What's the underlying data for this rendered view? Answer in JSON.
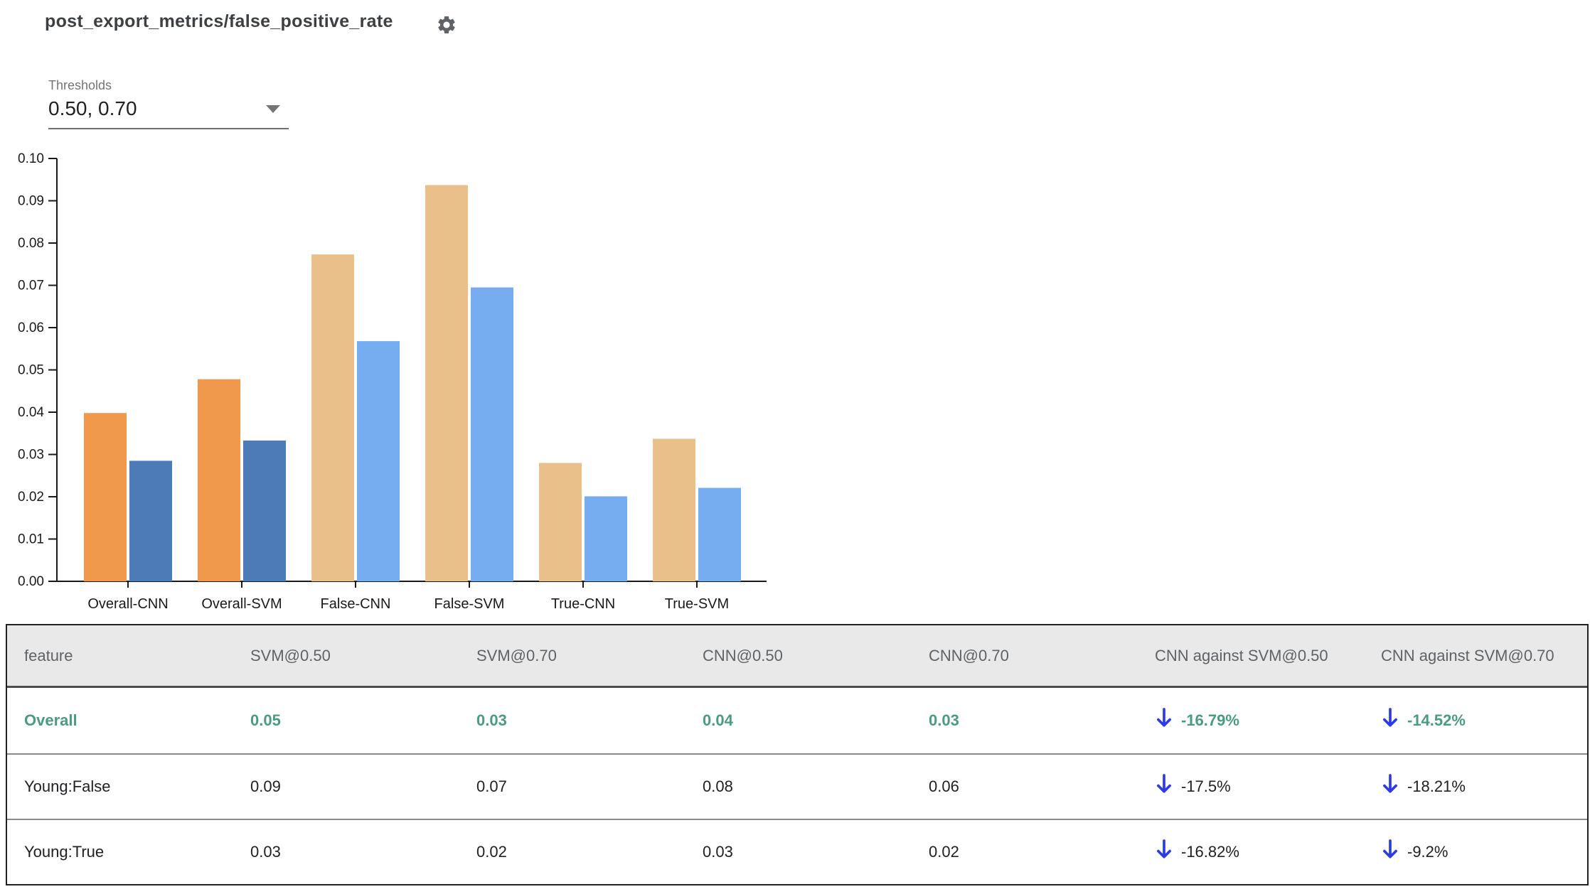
{
  "header": {
    "title": "post_export_metrics/false_positive_rate",
    "settings_icon": "gear"
  },
  "controls": {
    "thresholds_label": "Thresholds",
    "thresholds_value": "0.50, 0.70",
    "dropdown_icon": "caret-down"
  },
  "chart_data": {
    "type": "bar",
    "title": "post_export_metrics/false_positive_rate",
    "categories": [
      "Overall-CNN",
      "Overall-SVM",
      "False-CNN",
      "False-SVM",
      "True-CNN",
      "True-SVM"
    ],
    "series": [
      {
        "name": "threshold 0.50",
        "values": [
          0.0398,
          0.0478,
          0.0773,
          0.0937,
          0.028,
          0.0337
        ],
        "colors": [
          "#F0994D",
          "#F0994D",
          "#E9C089",
          "#E9C089",
          "#E9C089",
          "#E9C089"
        ]
      },
      {
        "name": "threshold 0.70",
        "values": [
          0.0285,
          0.0333,
          0.0568,
          0.0695,
          0.0201,
          0.0221
        ],
        "colors": [
          "#4C7BB8",
          "#4C7BB8",
          "#75ADF0",
          "#75ADF0",
          "#75ADF0",
          "#75ADF0"
        ]
      }
    ],
    "xlabel": "",
    "ylabel": "",
    "ylim": [
      0,
      0.1
    ],
    "yticks": [
      "0.00",
      "0.01",
      "0.02",
      "0.03",
      "0.04",
      "0.05",
      "0.06",
      "0.07",
      "0.08",
      "0.09",
      "0.10"
    ],
    "grid": false,
    "legend": "none"
  },
  "table": {
    "columns": [
      "feature",
      "SVM@0.50",
      "SVM@0.70",
      "CNN@0.50",
      "CNN@0.70",
      "CNN against SVM@0.50",
      "CNN against SVM@0.70"
    ],
    "rows": [
      {
        "feature": "Overall",
        "values": [
          "0.05",
          "0.03",
          "0.04",
          "0.03"
        ],
        "deltas": [
          {
            "direction": "down",
            "text": "-16.79%"
          },
          {
            "direction": "down",
            "text": "-14.52%"
          }
        ],
        "highlight": true
      },
      {
        "feature": "Young:False",
        "values": [
          "0.09",
          "0.07",
          "0.08",
          "0.06"
        ],
        "deltas": [
          {
            "direction": "down",
            "text": "-17.5%"
          },
          {
            "direction": "down",
            "text": "-18.21%"
          }
        ],
        "highlight": false
      },
      {
        "feature": "Young:True",
        "values": [
          "0.03",
          "0.02",
          "0.03",
          "0.02"
        ],
        "deltas": [
          {
            "direction": "down",
            "text": "-16.82%"
          },
          {
            "direction": "down",
            "text": "-9.2%"
          }
        ],
        "highlight": false
      }
    ]
  },
  "palette": {
    "bar_overall_t50": "#F0994D",
    "bar_overall_t70": "#4C7BB8",
    "bar_slice_t50": "#E9C089",
    "bar_slice_t70": "#75ADF0",
    "highlight_green": "#4A9C7F",
    "arrow_blue": "#2B3BE8",
    "header_bg": "#E9E9E9",
    "header_text": "#5F6368",
    "cell_text": "#202124",
    "axis": "#1A1A1A"
  }
}
